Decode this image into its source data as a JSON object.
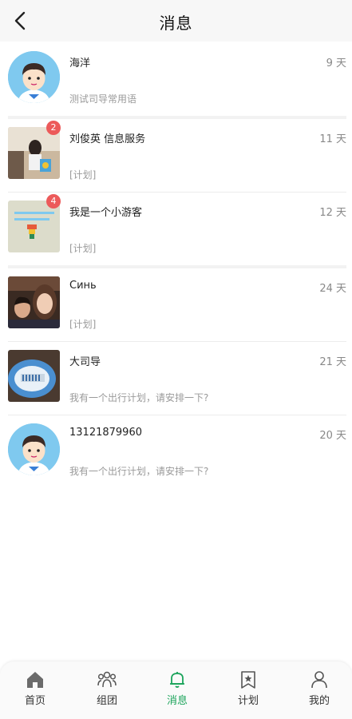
{
  "header": {
    "title": "消息"
  },
  "messages": [
    {
      "name": "海洋",
      "time": "9 天",
      "preview": "测试司导常用语",
      "badge": "",
      "avatar": "cartoon-boy"
    },
    {
      "name": "刘俊英 信息服务",
      "time": "11 天",
      "preview": "[计划]",
      "badge": "2",
      "avatar": "photo-woman"
    },
    {
      "name": "我是一个小游客",
      "time": "12 天",
      "preview": "[计划]",
      "badge": "4",
      "avatar": "photo-toy"
    },
    {
      "name": "Синь",
      "time": "24 天",
      "preview": "[计划]",
      "badge": "",
      "avatar": "photo-selfie"
    },
    {
      "name": "大司导",
      "time": "21 天",
      "preview": "我有一个出行计划，请安排一下?",
      "badge": "",
      "avatar": "photo-plate"
    },
    {
      "name": "13121879960",
      "time": "20 天",
      "preview": "我有一个出行计划，请安排一下?",
      "badge": "",
      "avatar": "cartoon-boy"
    }
  ],
  "tabbar": {
    "tabs": [
      {
        "label": "首页",
        "icon": "home-icon"
      },
      {
        "label": "组团",
        "icon": "group-icon"
      },
      {
        "label": "消息",
        "icon": "bell-icon",
        "active": true
      },
      {
        "label": "计划",
        "icon": "bookmark-star-icon"
      },
      {
        "label": "我的",
        "icon": "user-icon"
      }
    ]
  },
  "colors": {
    "accent": "#1aa35a",
    "badge": "#ec5a5a",
    "avatar_bg": "#7fc9ef"
  }
}
